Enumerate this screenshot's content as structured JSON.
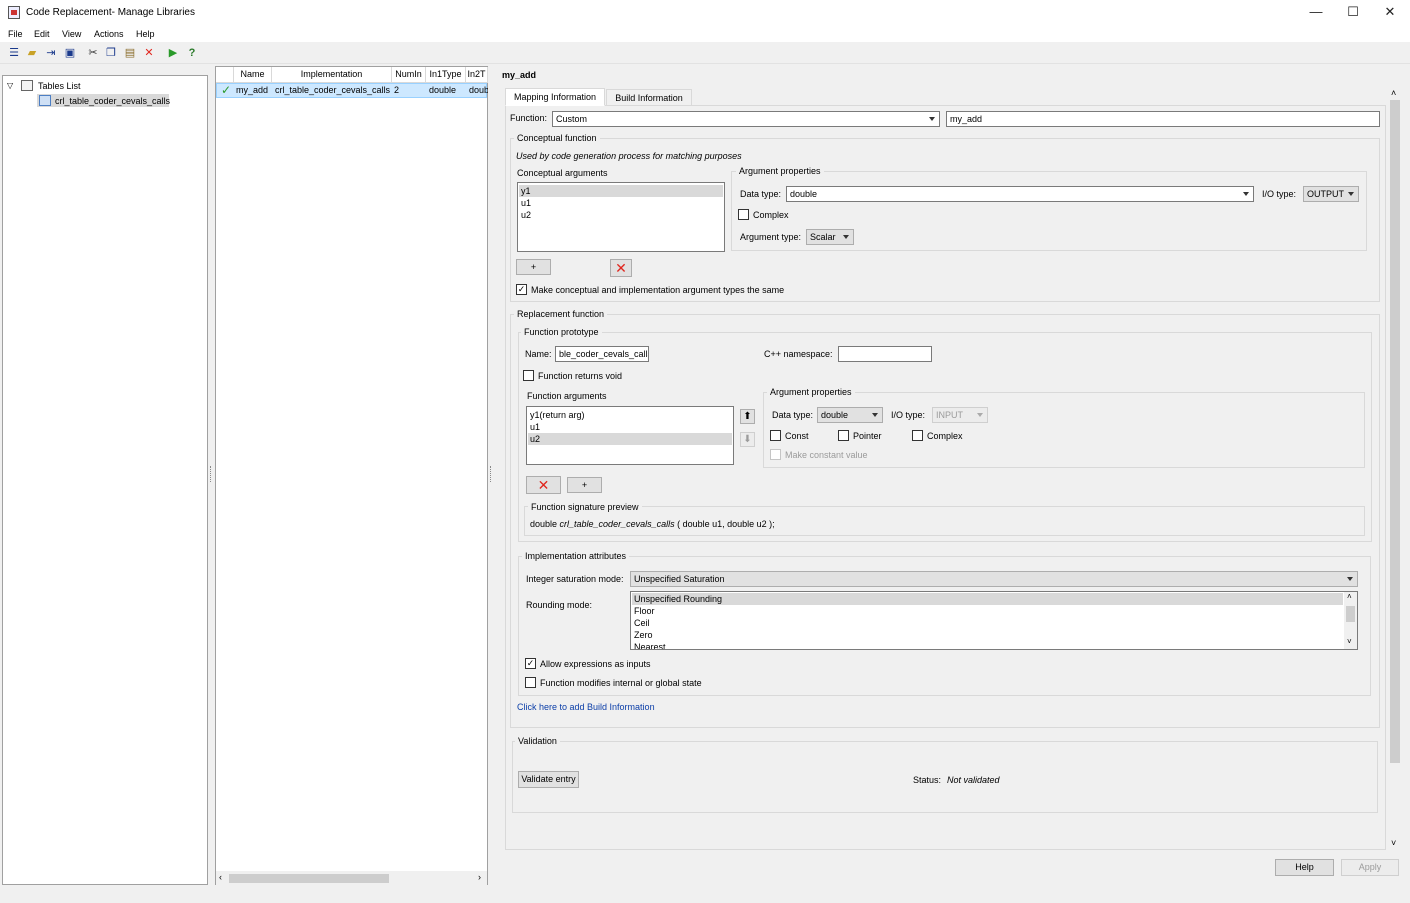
{
  "window": {
    "title": "Code Replacement- Manage Libraries",
    "minimize": "—",
    "maximize": "☐",
    "close": "✕"
  },
  "menu": [
    "File",
    "Edit",
    "View",
    "Actions",
    "Help"
  ],
  "toolbar": {
    "icons": [
      "new-table-icon",
      "open-icon",
      "new-entry-icon",
      "save-icon",
      "cut-icon",
      "copy-icon",
      "paste-icon",
      "delete-icon",
      "validate-run-icon",
      "help-icon"
    ]
  },
  "tree": {
    "root": "Tables List",
    "child": "crl_table_coder_cevals_calls"
  },
  "table": {
    "columns": [
      "Name",
      "Implementation",
      "NumIn",
      "In1Type",
      "In2T"
    ],
    "rows": [
      {
        "name": "my_add",
        "implementation": "crl_table_coder_cevals_calls",
        "numin": "2",
        "in1type": "double",
        "in2type": "doub"
      }
    ]
  },
  "detail": {
    "heading": "my_add",
    "tabs": [
      "Mapping Information",
      "Build Information"
    ],
    "function_label": "Function:",
    "function_value": "Custom",
    "function_name": "my_add",
    "conceptual": {
      "title": "Conceptual function",
      "note": "Used by code generation process for matching purposes",
      "args_title": "Conceptual arguments",
      "args": [
        "y1",
        "u1",
        "u2"
      ],
      "add_label": "+",
      "props_title": "Argument properties",
      "data_type_label": "Data type:",
      "data_type": "double",
      "io_label": "I/O type:",
      "io_value": "OUTPUT",
      "complex_label": "Complex",
      "arg_type_label": "Argument type:",
      "arg_type": "Scalar",
      "same_types_label": "Make conceptual and implementation argument types the same"
    },
    "replacement": {
      "title": "Replacement function",
      "prototype_title": "Function prototype",
      "name_label": "Name:",
      "name_value": "ble_coder_cevals_calls",
      "ns_label": "C++ namespace:",
      "ns_value": "",
      "returns_void_label": "Function returns void",
      "args_title": "Function arguments",
      "args": [
        "y1(return arg)",
        "u1",
        "u2"
      ],
      "add_label": "+",
      "props_title": "Argument properties",
      "data_type_label": "Data type:",
      "data_type": "double",
      "io_label": "I/O type:",
      "io_value": "INPUT",
      "const_label": "Const",
      "pointer_label": "Pointer",
      "complex_label": "Complex",
      "make_const_label": "Make constant value",
      "sig_title": "Function signature preview",
      "sig_prefix": "double ",
      "sig_name": "crl_table_coder_cevals_calls",
      "sig_suffix": " ( double u1, double u2 );"
    },
    "impl": {
      "title": "Implementation attributes",
      "sat_label": "Integer saturation mode:",
      "sat_value": "Unspecified Saturation",
      "round_label": "Rounding mode:",
      "round_options": [
        "Unspecified Rounding",
        "Floor",
        "Ceil",
        "Zero",
        "Nearest"
      ],
      "allow_expr_label": "Allow expressions as inputs",
      "modifies_state_label": "Function modifies internal or global state"
    },
    "build_link": "Click here to add Build Information",
    "validation": {
      "title": "Validation",
      "button": "Validate entry",
      "status_label": "Status:",
      "status_value": "Not validated"
    }
  },
  "footer": {
    "help": "Help",
    "apply": "Apply"
  }
}
